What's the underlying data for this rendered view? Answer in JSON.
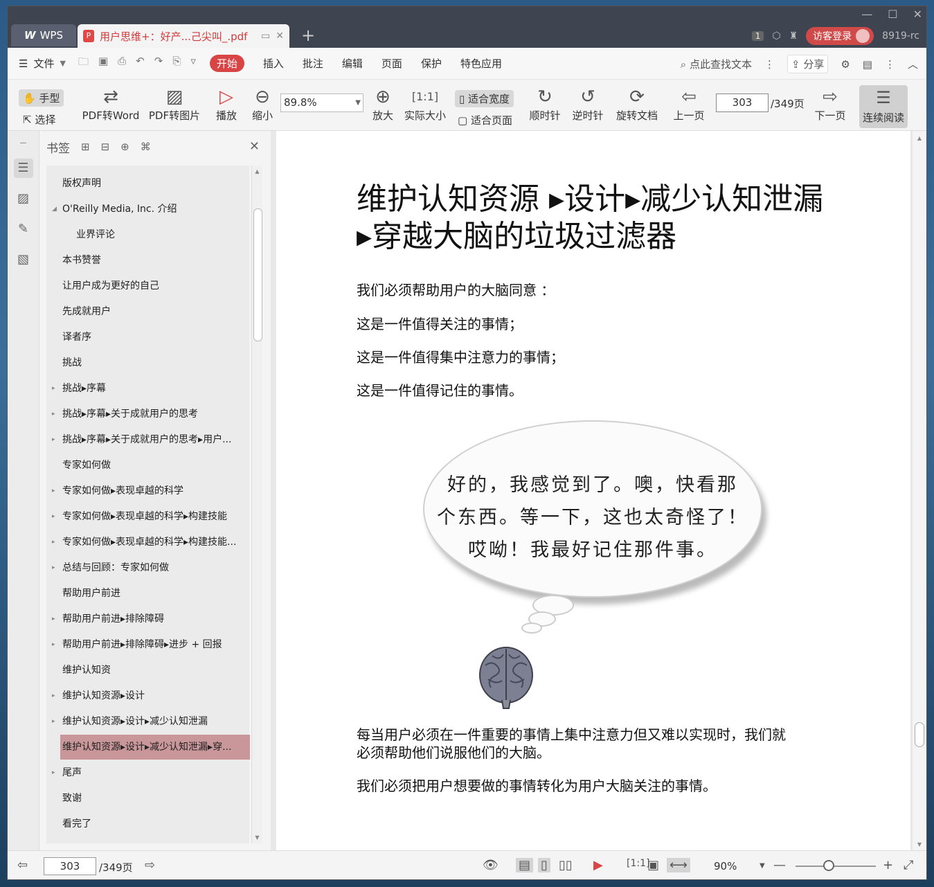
{
  "titlebar": {
    "app_tab": "WPS",
    "doc_tab": "用户思维+：好产...己尖叫_.pdf",
    "page_badge": "1",
    "login": "访客登录",
    "version": "8919-rc"
  },
  "menu": {
    "file": "文件",
    "items": [
      "开始",
      "插入",
      "批注",
      "编辑",
      "页面",
      "保护",
      "特色应用"
    ],
    "search": "点此查找文本",
    "share": "分享"
  },
  "toolbar": {
    "hand": "手型",
    "select": "选择",
    "pdf_to_word": "PDF转Word",
    "pdf_to_image": "PDF转图片",
    "play": "播放",
    "zoom_out": "缩小",
    "zoom_value": "89.8%",
    "zoom_in": "放大",
    "actual_size": "实际大小",
    "fit_width": "适合宽度",
    "fit_page": "适合页面",
    "clockwise": "顺时针",
    "counterclockwise": "逆时针",
    "rotate_doc": "旋转文档",
    "prev_page": "上一页",
    "current_page": "303",
    "total_pages": "/349页",
    "next_page": "下一页",
    "continuous": "连续阅读"
  },
  "bookmarks": {
    "title": "书签",
    "items": [
      {
        "label": "版权声明",
        "indent": 0,
        "expander": false
      },
      {
        "label": "O'Reilly Media, Inc. 介绍",
        "indent": 0,
        "expander": "open"
      },
      {
        "label": "业界评论",
        "indent": 1,
        "expander": false
      },
      {
        "label": "本书赞誉",
        "indent": 0,
        "expander": false
      },
      {
        "label": "让用户成为更好的自己",
        "indent": 0,
        "expander": false
      },
      {
        "label": "先成就用户",
        "indent": 0,
        "expander": false
      },
      {
        "label": "译者序",
        "indent": 0,
        "expander": false
      },
      {
        "label": "挑战",
        "indent": 0,
        "expander": false
      },
      {
        "label": "挑战▸序幕",
        "indent": 0,
        "expander": "closed"
      },
      {
        "label": "挑战▸序幕▸关于成就用户的思考",
        "indent": 0,
        "expander": "closed"
      },
      {
        "label": "挑战▸序幕▸关于成就用户的思考▸用户...",
        "indent": 0,
        "expander": "closed"
      },
      {
        "label": "专家如何做",
        "indent": 0,
        "expander": false
      },
      {
        "label": "专家如何做▸表现卓越的科学",
        "indent": 0,
        "expander": "closed"
      },
      {
        "label": "专家如何做▸表现卓越的科学▸构建技能",
        "indent": 0,
        "expander": "closed"
      },
      {
        "label": "专家如何做▸表现卓越的科学▸构建技能...",
        "indent": 0,
        "expander": "closed"
      },
      {
        "label": "总结与回顾：专家如何做",
        "indent": 0,
        "expander": "closed"
      },
      {
        "label": "帮助用户前进",
        "indent": 0,
        "expander": false
      },
      {
        "label": "帮助用户前进▸排除障碍",
        "indent": 0,
        "expander": "closed"
      },
      {
        "label": "帮助用户前进▸排除障碍▸进步 + 回报",
        "indent": 0,
        "expander": "closed"
      },
      {
        "label": "维护认知资",
        "indent": 0,
        "expander": false
      },
      {
        "label": "维护认知资源▸设计",
        "indent": 0,
        "expander": "closed"
      },
      {
        "label": "维护认知资源▸设计▸减少认知泄漏",
        "indent": 0,
        "expander": "closed"
      },
      {
        "label": "维护认知资源▸设计▸减少认知泄漏▸穿...",
        "indent": 0,
        "expander": "closed",
        "selected": true
      },
      {
        "label": "尾声",
        "indent": 0,
        "expander": "closed"
      },
      {
        "label": "致谢",
        "indent": 0,
        "expander": false
      },
      {
        "label": "看完了",
        "indent": 0,
        "expander": false
      }
    ]
  },
  "document": {
    "heading_line1": "维护认知资源 ▸设计▸减少认知泄漏",
    "heading_line2": "▸穿越大脑的垃圾过滤器",
    "para1": "我们必须帮助用户的大脑同意 ：",
    "para2": "这是一件值得关注的事情；",
    "para3": "这是一件值得集中注意力的事情；",
    "para4": "这是一件值得记住的事情。",
    "bubble_line1": "好的，我感觉到了。噢，快看那",
    "bubble_line2": "个东西。等一下，这也太奇怪了！",
    "bubble_line3": "哎呦！我最好记住那件事。",
    "para5_line1": "每当用户必须在一件重要的事情上集中注意力但又难以实现时，我们就",
    "para5_line2": "必须帮助他们说服他们的大脑。",
    "para6": "我们必须把用户想要做的事情转化为用户大脑关注的事情。"
  },
  "statusbar": {
    "current_page": "303",
    "total_pages": "/349页",
    "zoom": "90%"
  },
  "colors": {
    "accent": "#d94444",
    "selected_bookmark": "#c9979a",
    "titlebar": "#3f4451"
  }
}
